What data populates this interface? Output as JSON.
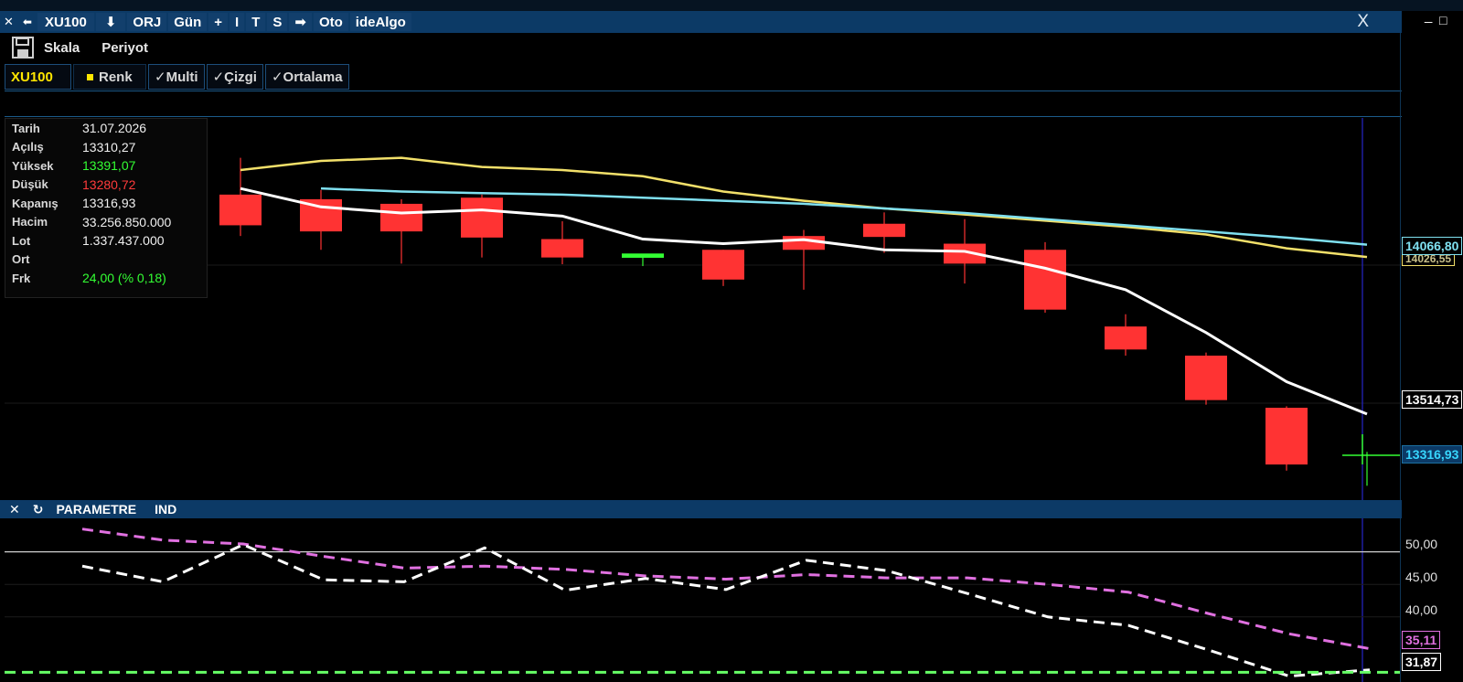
{
  "titlebar": {
    "close": "✕",
    "back": "⬅",
    "symbol": "XU100",
    "download": "⬇",
    "orj": "ORJ",
    "period": "Gün",
    "plus": "+",
    "line": "I",
    "t": "T",
    "s": "S",
    "arrow": "➡",
    "auto": "Oto",
    "brand": "ideAlgo"
  },
  "window": {
    "close": "X",
    "minimize": "_",
    "restore": "□"
  },
  "toolbar1": {
    "skala": "Skala",
    "periyot": "Periyot"
  },
  "toolbar2": {
    "symbol": "XU100",
    "renk": "Renk",
    "multi": "✓Multi",
    "cizgi": "✓Çizgi",
    "ortalama": "✓Ortalama"
  },
  "info": [
    {
      "key": "Tarih",
      "value": "31.07.2026",
      "color": "#f0f0f0"
    },
    {
      "key": "Açılış",
      "value": "13310,27",
      "color": "#f0f0f0"
    },
    {
      "key": "Yüksek",
      "value": "13391,07",
      "color": "#33ff33"
    },
    {
      "key": "Düşük",
      "value": "13280,72",
      "color": "#ff3b3b"
    },
    {
      "key": "Kapanış",
      "value": "13316,93",
      "color": "#f0f0f0"
    },
    {
      "key": "Hacim",
      "value": "33.256.850.000",
      "color": "#f0f0f0"
    },
    {
      "key": "Lot",
      "value": "1.337.437.000",
      "color": "#f0f0f0"
    },
    {
      "key": "Ort",
      "value": "",
      "color": "#f0f0f0"
    },
    {
      "key": "Frk",
      "value": "24,00 (% 0,18)",
      "color": "#33ff33"
    }
  ],
  "price_labels": {
    "ma_cyan": "14066,80",
    "ma_yellow_partial": "14026,55",
    "ma_white": "13514,73",
    "last": "13316,93"
  },
  "panel": {
    "close": "✕",
    "refresh": "↻",
    "param": "PARAMETRE",
    "ind": "IND"
  },
  "ind_scale": [
    "50,00",
    "45,00",
    "40,00"
  ],
  "ind_labels": {
    "pink": "35,11",
    "white": "31,87"
  },
  "colors": {
    "up": "#33ff33",
    "down": "#ff3333",
    "ma_yellow": "#f2e06a",
    "ma_cyan": "#7fe0f0",
    "ma_white": "#ffffff",
    "ind_pink": "#e070e0",
    "ind_green": "#66ff66",
    "accent": "#0c3a66"
  },
  "chart_data": [
    {
      "type": "candlestick",
      "title": "XU100",
      "candles": [
        {
          "open": 14400,
          "high": 14455,
          "low": 14300,
          "close": 14250
        },
        {
          "open": 14230,
          "high": 14350,
          "low": 14095,
          "close": 14130
        },
        {
          "open": 14215,
          "high": 14245,
          "low": 14050,
          "close": 14110
        },
        {
          "open": 14200,
          "high": 14215,
          "low": 14005,
          "close": 14110
        },
        {
          "open": 14220,
          "high": 14230,
          "low": 14025,
          "close": 14090
        },
        {
          "open": 14085,
          "high": 14143,
          "low": 14003,
          "close": 14025
        },
        {
          "open": 14024,
          "high": 14030,
          "low": 13997,
          "close": 14038
        },
        {
          "open": 14050,
          "high": 14050,
          "low": 13932,
          "close": 13953
        },
        {
          "open": 14095,
          "high": 14115,
          "low": 13920,
          "close": 14050
        },
        {
          "open": 14135,
          "high": 14172,
          "low": 14040,
          "close": 14092
        },
        {
          "open": 14070,
          "high": 14150,
          "low": 13940,
          "close": 14005
        },
        {
          "open": 14050,
          "high": 14075,
          "low": 13845,
          "close": 13855
        },
        {
          "open": 13800,
          "high": 13840,
          "low": 13705,
          "close": 13725
        },
        {
          "open": 13705,
          "high": 13715,
          "low": 13545,
          "close": 13560
        },
        {
          "open": 13535,
          "high": 13540,
          "low": 13330,
          "close": 13350
        },
        {
          "open": 13310.27,
          "high": 13391.07,
          "low": 13280.72,
          "close": 13316.93
        }
      ],
      "ma_yellow": [
        14310,
        14340,
        14350,
        14320,
        14310,
        14290,
        14240,
        14210,
        14185,
        14165,
        14145,
        14125,
        14100,
        14055,
        14026.55
      ],
      "ma_cyan": [
        14250,
        14240,
        14235,
        14230,
        14220,
        14210,
        14200,
        14185,
        14170,
        14150,
        14130,
        14110,
        14090,
        14066.8
      ],
      "ma_white": [
        14250,
        14190,
        14170,
        14180,
        14160,
        14085,
        14070,
        14083,
        14050,
        14045,
        13990,
        13920,
        13780,
        13620,
        13514.73
      ],
      "ylim": [
        13240,
        14480
      ]
    },
    {
      "type": "line",
      "series": [
        {
          "values": [
            53.5,
            51.8,
            51.2,
            49.3,
            47.5,
            47.8,
            47.3,
            46.3,
            45.8,
            46.5,
            46.0,
            46.0,
            45.0,
            43.8,
            40.5,
            37.4,
            35.11
          ]
        },
        {
          "values": [
            47.8,
            45.4,
            51.1,
            45.7,
            45.4,
            50.6,
            44.1,
            45.9,
            44.2,
            48.7,
            47.1,
            43.6,
            40.0,
            38.7,
            34.9,
            30.9,
            31.87
          ]
        },
        {
          "values": [
            31.5
          ]
        }
      ],
      "ylim": [
        30,
        55
      ]
    }
  ]
}
